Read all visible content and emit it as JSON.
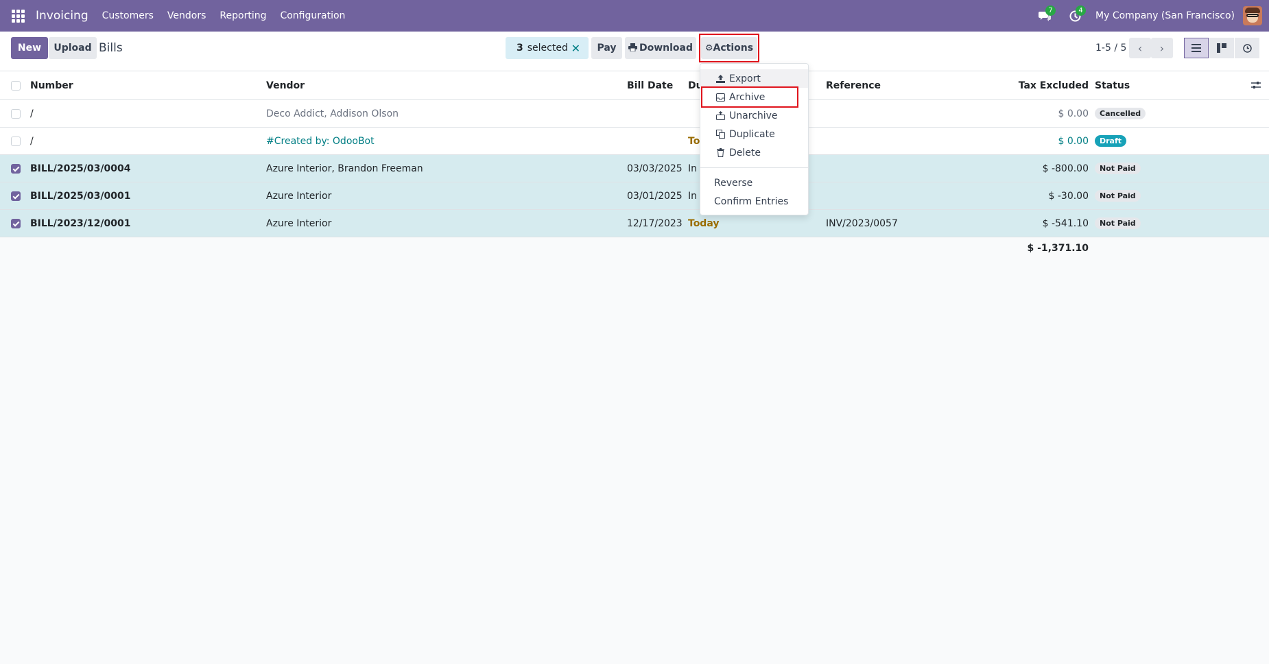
{
  "nav": {
    "brand": "Invoicing",
    "menu": [
      "Customers",
      "Vendors",
      "Reporting",
      "Configuration"
    ],
    "chat_count": "7",
    "activity_count": "4",
    "company": "My Company (San Francisco)"
  },
  "control": {
    "new_label": "New",
    "upload_label": "Upload",
    "title": "Bills",
    "selected_count": "3",
    "selected_text": "selected",
    "pay_label": "Pay",
    "download_label": "Download",
    "actions_label": "Actions",
    "pager": "1-5 / 5"
  },
  "table": {
    "headers": {
      "number": "Number",
      "vendor": "Vendor",
      "bill_date": "Bill Date",
      "due": "Du",
      "reference": "Reference",
      "tax_excluded": "Tax Excluded",
      "status": "Status"
    },
    "rows": [
      {
        "number": "/",
        "vendor": "Deco Addict, Addison Olson",
        "bill_date": "",
        "due": "",
        "reference": "",
        "tax": "$ 0.00",
        "status": "Cancelled"
      },
      {
        "number": "/",
        "vendor": "#Created by: OdooBot",
        "bill_date": "",
        "due": "To",
        "reference": "",
        "tax": "$ 0.00",
        "status": "Draft"
      },
      {
        "number": "BILL/2025/03/0004",
        "vendor": "Azure Interior, Brandon Freeman",
        "bill_date": "03/03/2025",
        "due": "In",
        "reference": "",
        "tax": "$ -800.00",
        "status": "Not Paid"
      },
      {
        "number": "BILL/2025/03/0001",
        "vendor": "Azure Interior",
        "bill_date": "03/01/2025",
        "due": "In",
        "reference": "",
        "tax": "$ -30.00",
        "status": "Not Paid"
      },
      {
        "number": "BILL/2023/12/0001",
        "vendor": "Azure Interior",
        "bill_date": "12/17/2023",
        "due": "Today",
        "reference": "INV/2023/0057",
        "tax": "$ -541.10",
        "status": "Not Paid"
      }
    ],
    "total": "$ -1,371.10"
  },
  "dropdown": {
    "items": [
      "Export",
      "Archive",
      "Unarchive",
      "Duplicate",
      "Delete"
    ],
    "extra": [
      "Reverse",
      "Confirm Entries"
    ]
  },
  "colors": {
    "brand": "#71639e",
    "selected_row": "#d6ebef",
    "highlight": "#e0151d",
    "teal": "#017e84"
  }
}
